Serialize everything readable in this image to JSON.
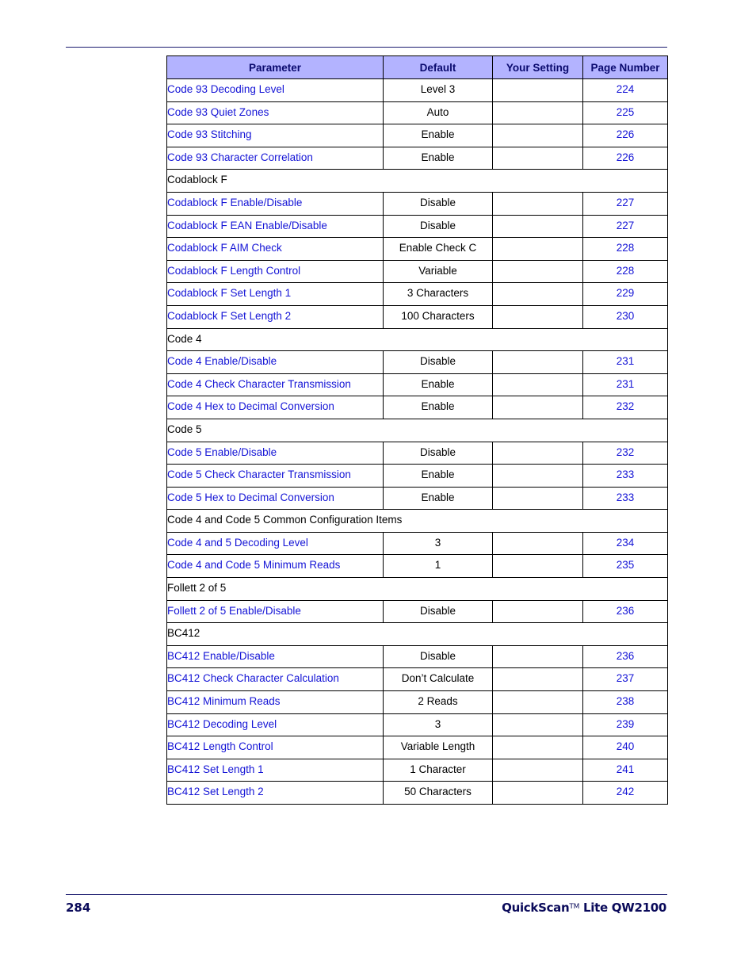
{
  "table": {
    "headers": {
      "parameter": "Parameter",
      "default": "Default",
      "your_setting": "Your Setting",
      "page_number": "Page Number"
    },
    "rows": [
      {
        "type": "item",
        "parameter": "Code 93 Decoding Level",
        "default": "Level 3",
        "page": "224"
      },
      {
        "type": "item",
        "parameter": "Code 93 Quiet Zones",
        "default": "Auto",
        "page": "225"
      },
      {
        "type": "item",
        "parameter": "Code 93 Stitching",
        "default": "Enable",
        "page": "226"
      },
      {
        "type": "item",
        "parameter": "Code 93 Character Correlation",
        "default": "Enable",
        "page": "226"
      },
      {
        "type": "section",
        "parameter": "Codablock F"
      },
      {
        "type": "item",
        "parameter": "Codablock F Enable/Disable",
        "default": "Disable",
        "page": "227"
      },
      {
        "type": "item",
        "parameter": "Codablock F EAN Enable/Disable",
        "default": "Disable",
        "page": "227"
      },
      {
        "type": "item",
        "parameter": "Codablock F AIM Check",
        "default": "Enable Check C",
        "page": "228"
      },
      {
        "type": "item",
        "parameter": "Codablock F Length Control",
        "default": "Variable",
        "page": "228"
      },
      {
        "type": "item",
        "parameter": "Codablock F Set Length 1",
        "default": "3 Characters",
        "page": "229"
      },
      {
        "type": "item",
        "parameter": "Codablock F Set Length 2",
        "default": "100 Characters",
        "page": "230"
      },
      {
        "type": "section",
        "parameter": "Code 4"
      },
      {
        "type": "item",
        "parameter": "Code 4 Enable/Disable",
        "default": "Disable",
        "page": "231"
      },
      {
        "type": "item",
        "parameter": "Code 4 Check Character Transmission",
        "default": "Enable",
        "page": "231"
      },
      {
        "type": "item",
        "parameter": "Code 4 Hex to Decimal Conversion",
        "default": "Enable",
        "page": "232"
      },
      {
        "type": "section",
        "parameter": "Code 5"
      },
      {
        "type": "item",
        "parameter": "Code 5 Enable/Disable",
        "default": "Disable",
        "page": "232"
      },
      {
        "type": "item",
        "parameter": "Code 5 Check Character Transmission",
        "default": "Enable",
        "page": "233"
      },
      {
        "type": "item",
        "parameter": "Code 5 Hex to Decimal Conversion",
        "default": "Enable",
        "page": "233"
      },
      {
        "type": "section",
        "parameter": "Code 4 and Code 5 Common Configuration Items"
      },
      {
        "type": "item",
        "parameter": "Code 4 and 5 Decoding Level",
        "default": "3",
        "page": "234"
      },
      {
        "type": "item",
        "parameter": "Code 4 and Code 5 Minimum Reads",
        "default": "1",
        "page": "235"
      },
      {
        "type": "section",
        "parameter": "Follett 2 of 5"
      },
      {
        "type": "item",
        "parameter": "Follett 2 of 5 Enable/Disable",
        "default": "Disable",
        "page": "236"
      },
      {
        "type": "section",
        "parameter": "BC412"
      },
      {
        "type": "item",
        "parameter": "BC412 Enable/Disable",
        "default": "Disable",
        "page": "236"
      },
      {
        "type": "item",
        "parameter": "BC412 Check Character Calculation",
        "default": "Don’t Calculate",
        "page": "237"
      },
      {
        "type": "item",
        "parameter": "BC412 Minimum Reads",
        "default": "2 Reads",
        "page": "238"
      },
      {
        "type": "item",
        "parameter": "BC412 Decoding Level",
        "default": "3",
        "page": "239"
      },
      {
        "type": "item",
        "parameter": "BC412 Length Control",
        "default": "Variable Length",
        "page": "240"
      },
      {
        "type": "item",
        "parameter": "BC412 Set Length 1",
        "default": "1 Character",
        "page": "241"
      },
      {
        "type": "item",
        "parameter": "BC412 Set Length 2",
        "default": "50 Characters",
        "page": "242"
      }
    ]
  },
  "footer": {
    "page_number": "284",
    "product_name": "QuickScan",
    "trademark": "TM",
    "product_model": " Lite QW2100"
  },
  "colors": {
    "header_bg": "#b3b3ff",
    "link": "#1414d6",
    "rule": "#1a1a6e"
  }
}
